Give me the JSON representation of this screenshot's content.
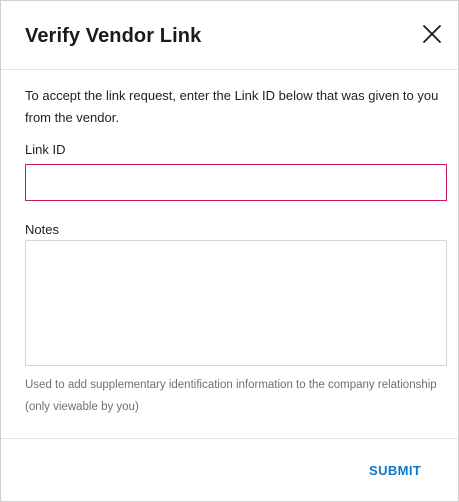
{
  "dialog": {
    "title": "Verify Vendor Link",
    "instructions": "To accept the link request, enter the Link ID below that was given to you from the vendor.",
    "close_icon": "close-icon"
  },
  "fields": {
    "link_id": {
      "label": "Link ID",
      "value": "",
      "border_color": "#c51c67"
    },
    "notes": {
      "label": "Notes",
      "value": "",
      "helper_text": "Used to add supplementary identification information to the company relationship (only viewable by you)"
    }
  },
  "footer": {
    "submit_label": "SUBMIT",
    "submit_color": "#0b78d0"
  }
}
